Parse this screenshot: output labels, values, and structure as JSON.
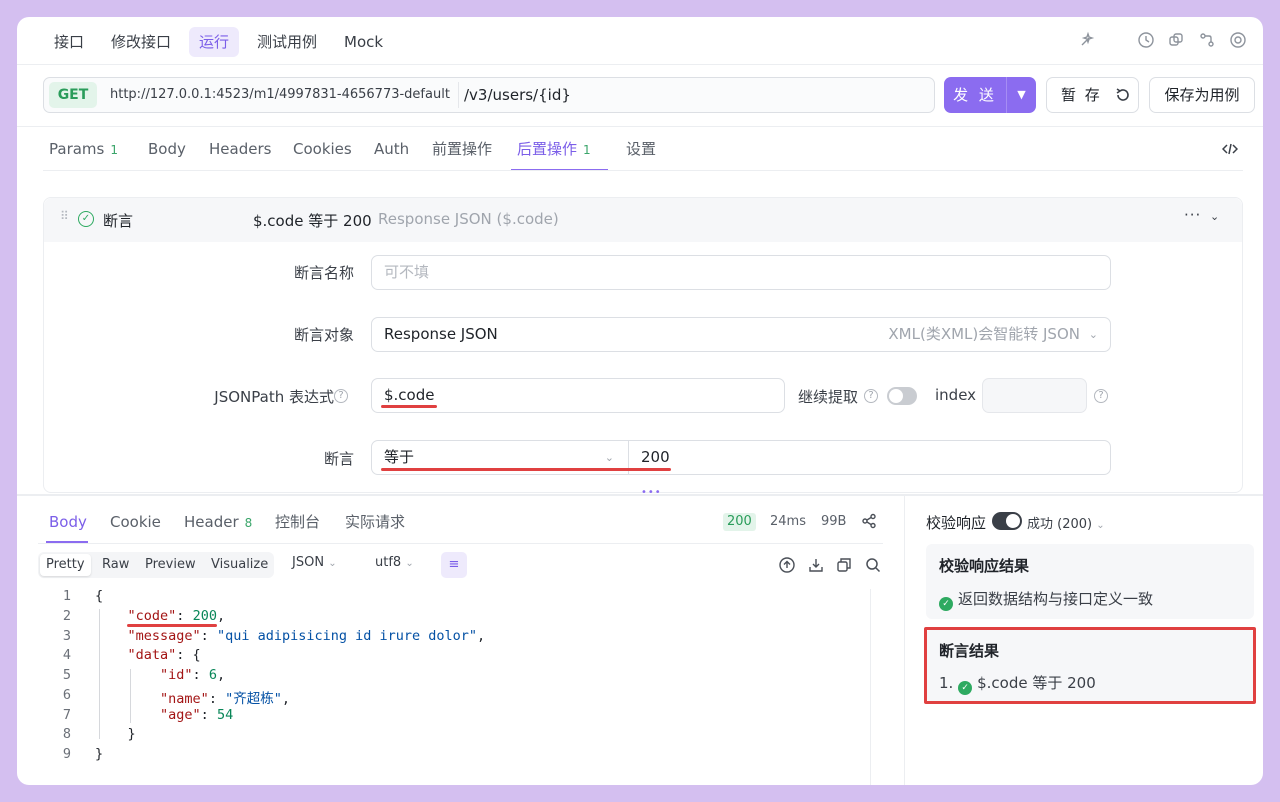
{
  "top_tabs": [
    "接口",
    "修改接口",
    "运行",
    "测试用例",
    "Mock"
  ],
  "request": {
    "method": "GET",
    "base_url": "http://127.0.0.1:4523/m1/4997831-4656773-default",
    "path": "/v3/users/{id}",
    "send_label": "发 送",
    "save_label": "暂 存",
    "save_case_label": "保存为用例"
  },
  "req_tabs": [
    {
      "label": "Params",
      "badge": "1"
    },
    {
      "label": "Body"
    },
    {
      "label": "Headers"
    },
    {
      "label": "Cookies"
    },
    {
      "label": "Auth"
    },
    {
      "label": "前置操作"
    },
    {
      "label": "后置操作",
      "badge": "1"
    },
    {
      "label": "设置"
    }
  ],
  "assertion": {
    "title": "断言",
    "summary": "$.code 等于 200",
    "summary_target": "Response JSON ($.code)",
    "name_label": "断言名称",
    "name_placeholder": "可不填",
    "object_label": "断言对象",
    "object_value": "Response JSON",
    "object_hint": "XML(类XML)会智能转 JSON",
    "jsonpath_label": "JSONPath 表达式",
    "jsonpath_value": "$.code",
    "continue_label": "继续提取",
    "index_label": "index",
    "assert_label": "断言",
    "operator": "等于",
    "expected": "200"
  },
  "response": {
    "tabs": [
      {
        "label": "Body"
      },
      {
        "label": "Cookie"
      },
      {
        "label": "Header",
        "badge": "8"
      },
      {
        "label": "控制台"
      },
      {
        "label": "实际请求"
      }
    ],
    "status": "200",
    "time": "24ms",
    "size": "99B",
    "view_modes": [
      "Pretty",
      "Raw",
      "Preview",
      "Visualize"
    ],
    "format": "JSON",
    "encoding": "utf8",
    "line_numbers": [
      "1",
      "2",
      "3",
      "4",
      "5",
      "6",
      "7",
      "8",
      "9"
    ]
  },
  "validation": {
    "toggle_label": "校验响应",
    "status_label": "成功 (200)",
    "result_title": "校验响应结果",
    "result_text": "返回数据结构与接口定义一致",
    "assert_title": "断言结果",
    "assert_index": "1.",
    "assert_text": "$.code 等于 200"
  }
}
